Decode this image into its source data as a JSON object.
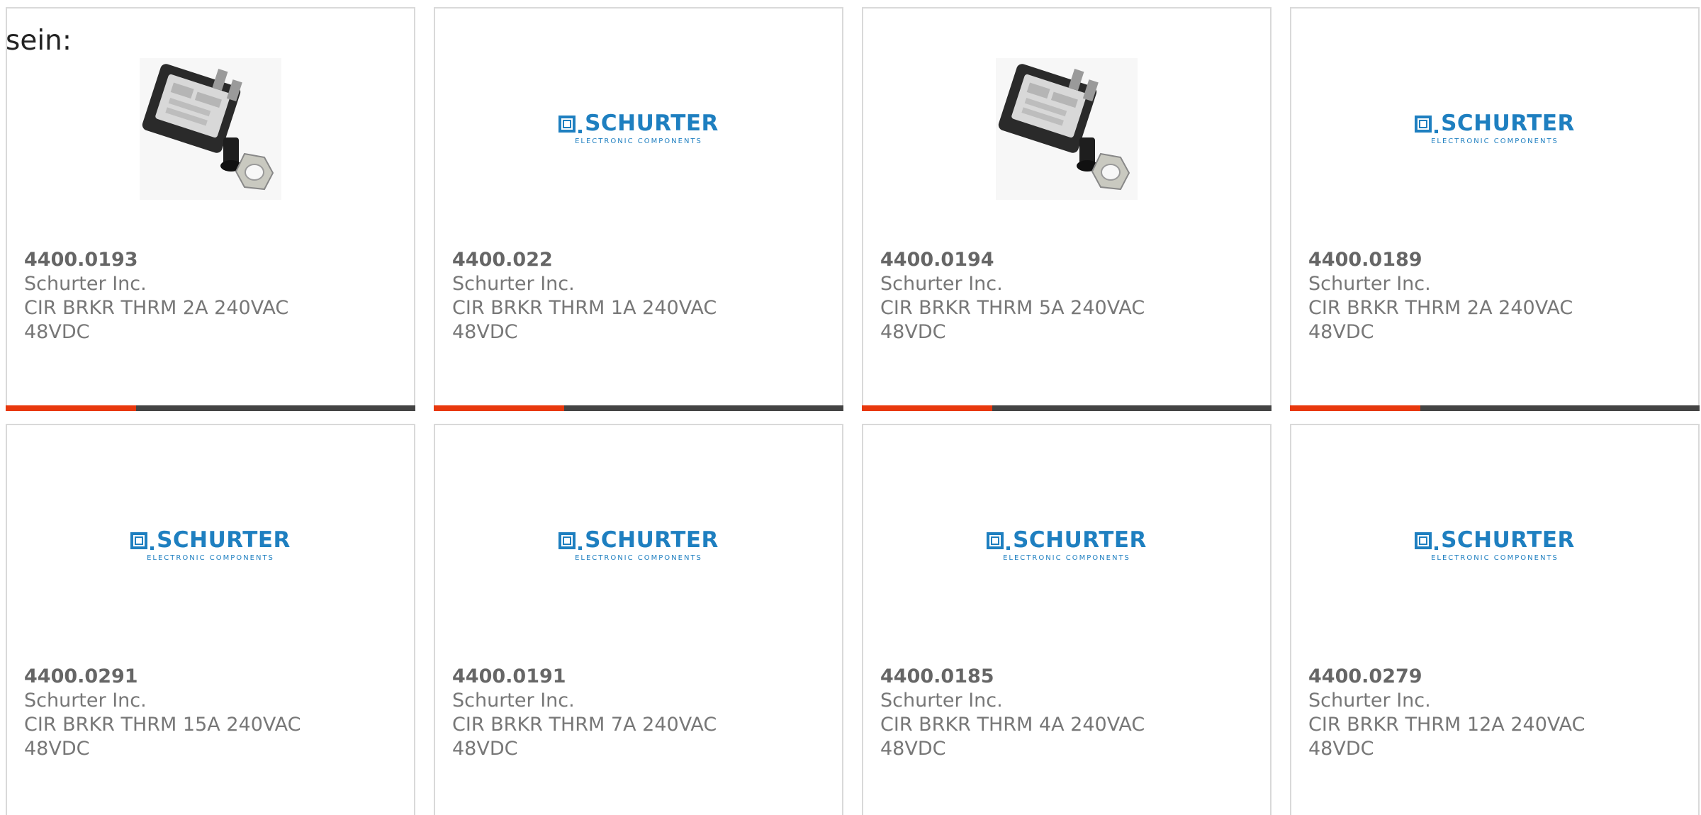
{
  "intro_text": "sein:",
  "colors": {
    "accent": "#e8380d",
    "underline_dark": "#444444",
    "logo_blue": "#1e7fc0",
    "card_border": "#d9d9d9",
    "text_dark": "#666666",
    "text_light": "#777777"
  },
  "brand_logo": {
    "text": "SCHURTER",
    "subtext": "ELECTRONIC COMPONENTS"
  },
  "products": [
    {
      "part_number": "4400.0193",
      "manufacturer": "Schurter Inc.",
      "description": "CIR BRKR THRM 2A 240VAC 48VDC",
      "image": "circuit-breaker-photo"
    },
    {
      "part_number": "4400.022",
      "manufacturer": "Schurter Inc.",
      "description": "CIR BRKR THRM 1A 240VAC 48VDC",
      "image": "schurter-logo"
    },
    {
      "part_number": "4400.0194",
      "manufacturer": "Schurter Inc.",
      "description": "CIR BRKR THRM 5A 240VAC 48VDC",
      "image": "circuit-breaker-photo"
    },
    {
      "part_number": "4400.0189",
      "manufacturer": "Schurter Inc.",
      "description": "CIR BRKR THRM 2A 240VAC 48VDC",
      "image": "schurter-logo"
    },
    {
      "part_number": "4400.0291",
      "manufacturer": "Schurter Inc.",
      "description": "CIR BRKR THRM 15A 240VAC 48VDC",
      "image": "schurter-logo"
    },
    {
      "part_number": "4400.0191",
      "manufacturer": "Schurter Inc.",
      "description": "CIR BRKR THRM 7A 240VAC 48VDC",
      "image": "schurter-logo"
    },
    {
      "part_number": "4400.0185",
      "manufacturer": "Schurter Inc.",
      "description": "CIR BRKR THRM 4A 240VAC 48VDC",
      "image": "schurter-logo"
    },
    {
      "part_number": "4400.0279",
      "manufacturer": "Schurter Inc.",
      "description": "CIR BRKR THRM 12A 240VAC 48VDC",
      "image": "schurter-logo"
    }
  ]
}
